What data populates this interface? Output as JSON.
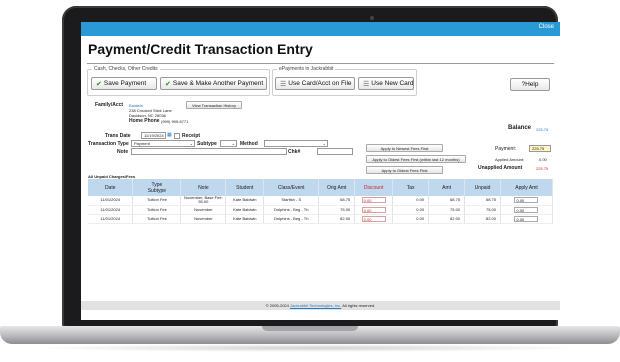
{
  "window": {
    "close_label": "Close",
    "title": "Payment/Credit Transaction Entry"
  },
  "cash_section": {
    "legend": "Cash, Checks, Other Credits",
    "save_label": "Save Payment",
    "save_another_label": "Save & Make Another Payment"
  },
  "epayments": {
    "legend": "ePayments in Jackrabbit",
    "card_on_file_label": "Use Card/Acct on File",
    "new_card_label": "Use New Card"
  },
  "help_label": "?Help",
  "family": {
    "label": "Family/Acct",
    "name": "Baldwin",
    "address1": "238 Crooked Stick Lane",
    "address2": "Davidson, NC  28036",
    "phone_label": "Home Phone",
    "phone": "(999) 999-6771",
    "history_button": "View Transaction History"
  },
  "balance": {
    "label": "Balance",
    "value": "225.75"
  },
  "form": {
    "trans_date_label": "Trans Date",
    "trans_date_value": "11/19/2024",
    "receipt_label": "Receipt",
    "type_label": "Transaction Type",
    "type_value": "Payment",
    "subtype_label": "Subtype",
    "method_label": "Method",
    "note_label": "Note",
    "chk_label": "Chk#"
  },
  "apply_buttons": {
    "newest": "Apply to Newest Fees First",
    "oldest_12": "Apply to Oldest Fees First (within last 12 months)",
    "oldest": "Apply to Oldest Fees First"
  },
  "summary": {
    "payment_label": "Payment:",
    "payment_value": "225.75",
    "applied_label": "Applied Amount:",
    "applied_value": "0.00",
    "unapplied_label": "Unapplied Amount",
    "unapplied_value": "225.75"
  },
  "table": {
    "caption": "All Unpaid Charges/Fees",
    "headers": {
      "date": "Date",
      "type1": "Type",
      "type2": "Subtype",
      "note": "Note",
      "student": "Student",
      "class_event": "Class/Event",
      "orig_amt": "Orig Amt",
      "discount": "Discount",
      "tax": "Tax",
      "amt": "Amt",
      "unpaid": "Unpaid",
      "apply_amt": "Apply Amt"
    },
    "rows": [
      {
        "date": "11/01/2024",
        "type": "Tuition Fee",
        "note": "November, Base Fee: 55.00",
        "student": "Kate Baldwin",
        "class_event": "Starfish - S",
        "orig_amt": "68.75",
        "discount": "0.00",
        "tax": "0.00",
        "amt": "68.75",
        "unpaid": "68.75",
        "apply": "0.00"
      },
      {
        "date": "11/01/2024",
        "type": "Tuition Fee",
        "note": "November",
        "student": "Kate Baldwin",
        "class_event": "Dolphins - Beg - Th",
        "orig_amt": "75.00",
        "discount": "0.00",
        "tax": "0.00",
        "amt": "75.00",
        "unpaid": "75.00",
        "apply": "0.00"
      },
      {
        "date": "11/01/2024",
        "type": "Tuition Fee",
        "note": "November",
        "student": "Kate Baldwin",
        "class_event": "Dolphins - Beg - Th",
        "orig_amt": "82.00",
        "discount": "0.00",
        "tax": "0.00",
        "amt": "82.00",
        "unpaid": "82.00",
        "apply": "0.00"
      }
    ]
  },
  "footer": {
    "prefix": "© 2005-2024",
    "company": "Jackrabbit Technologies, Inc.",
    "suffix": "All rights reserved."
  },
  "colors": {
    "accent": "#2a9ad6",
    "header_bg": "#bfd8ee",
    "alert": "#d0212a",
    "payment_field": "#fff6c2"
  }
}
